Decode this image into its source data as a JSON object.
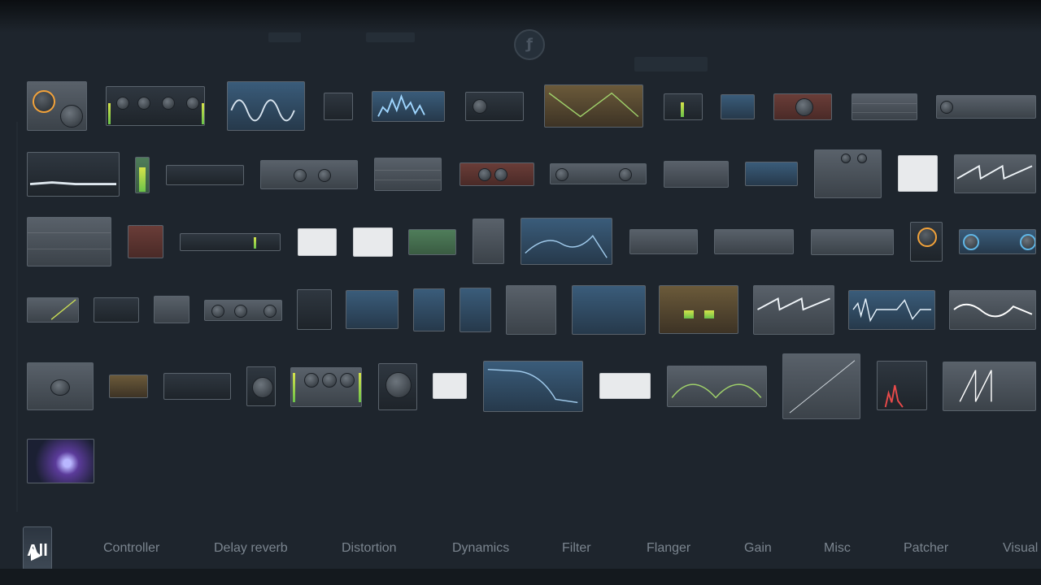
{
  "background_logo": "logo-icon",
  "plugins": [
    {
      "style": "plain"
    },
    {
      "style": "dark"
    },
    {
      "style": "dark"
    },
    {
      "style": "dark"
    },
    {
      "style": "blue"
    },
    {
      "style": "dark"
    },
    {
      "style": "gold"
    },
    {
      "style": "dark"
    },
    {
      "style": "blue"
    },
    {
      "style": "red"
    },
    {
      "style": "plain"
    },
    {
      "style": "plain"
    },
    {
      "style": "dark"
    },
    {
      "style": "green"
    },
    {
      "style": "dark"
    },
    {
      "style": "plain"
    },
    {
      "style": "plain"
    },
    {
      "style": "red"
    },
    {
      "style": "plain"
    },
    {
      "style": "plain"
    },
    {
      "style": "blue"
    },
    {
      "style": "plain"
    },
    {
      "style": "white"
    },
    {
      "style": "plain"
    },
    {
      "style": "plain"
    },
    {
      "style": "red"
    },
    {
      "style": "dark"
    },
    {
      "style": "white"
    },
    {
      "style": "white"
    },
    {
      "style": "green"
    },
    {
      "style": "plain"
    },
    {
      "style": "blue"
    },
    {
      "style": "plain"
    },
    {
      "style": "plain"
    },
    {
      "style": "plain"
    },
    {
      "style": "dark"
    },
    {
      "style": "blue"
    },
    {
      "style": "plain"
    },
    {
      "style": "dark"
    },
    {
      "style": "plain"
    },
    {
      "style": "plain"
    },
    {
      "style": "dark"
    },
    {
      "style": "blue"
    },
    {
      "style": "blue"
    },
    {
      "style": "blue"
    },
    {
      "style": "plain"
    },
    {
      "style": "blue"
    },
    {
      "style": "gold"
    },
    {
      "style": "plain"
    },
    {
      "style": "blue"
    },
    {
      "style": "plain"
    },
    {
      "style": "plain"
    },
    {
      "style": "red"
    },
    {
      "style": "dark"
    },
    {
      "style": "dark"
    },
    {
      "style": "plain"
    },
    {
      "style": "plain"
    },
    {
      "style": "white"
    },
    {
      "style": "blue"
    },
    {
      "style": "white"
    },
    {
      "style": "plain"
    },
    {
      "style": "plain"
    },
    {
      "style": "dark"
    },
    {
      "style": "dark"
    },
    {
      "style": "purple"
    }
  ],
  "tabs": [
    {
      "label": "All",
      "active": true
    },
    {
      "label": "Controller"
    },
    {
      "label": "Delay reverb"
    },
    {
      "label": "Distortion"
    },
    {
      "label": "Dynamics"
    },
    {
      "label": "Filter"
    },
    {
      "label": "Flanger"
    },
    {
      "label": "Gain"
    },
    {
      "label": "Misc"
    },
    {
      "label": "Patcher"
    },
    {
      "label": "Visual"
    }
  ],
  "colors": {
    "background": "#1e252d",
    "tab_text": "#7b858f",
    "active_tab_text": "#ffffff",
    "meter": "#d6e34a",
    "knob_accent": "#f2a23a"
  }
}
